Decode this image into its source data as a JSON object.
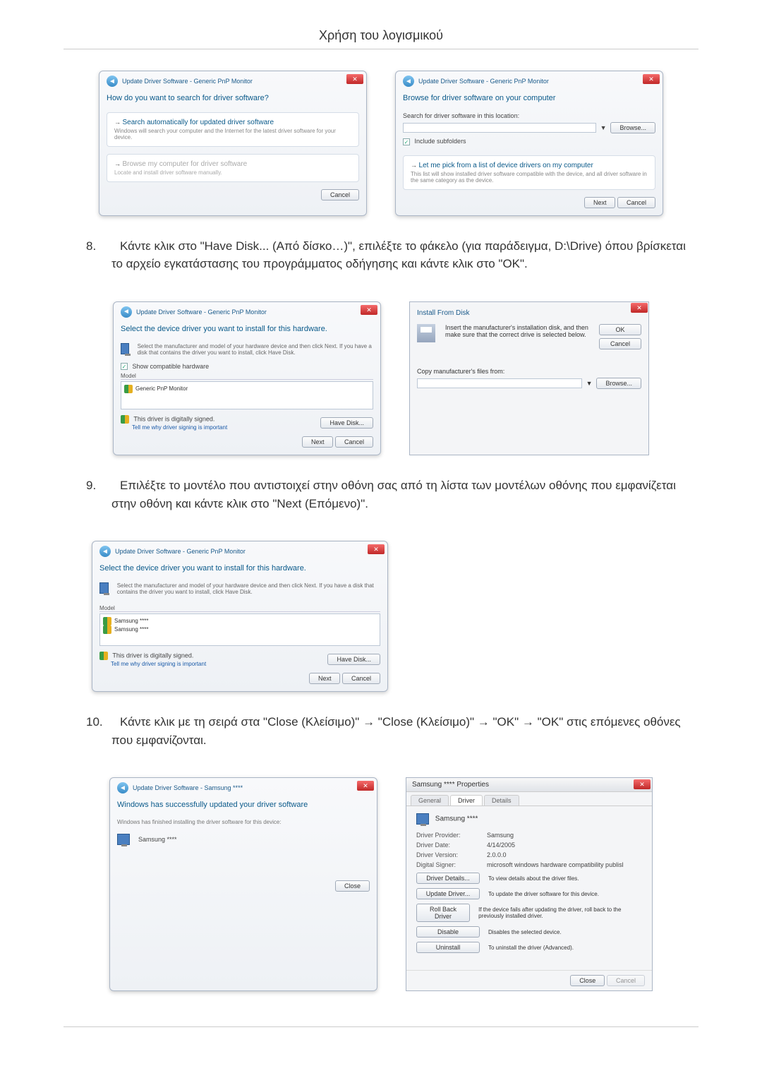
{
  "header": {
    "title": "Χρήση του λογισμικού"
  },
  "steps": {
    "s8": {
      "num": "8.",
      "text": "Κάντε κλικ στο \"Have Disk... (Από δίσκο…)\", επιλέξτε το φάκελο (για παράδειγμα, D:\\Drive) όπου βρίσκεται το αρχείο εγκατάστασης του προγράμματος οδήγησης και κάντε κλικ στο \"OK\"."
    },
    "s9": {
      "num": "9.",
      "text": "Επιλέξτε το μοντέλο που αντιστοιχεί στην οθόνη σας από τη λίστα των μοντέλων οθόνης που εμφανίζεται στην οθόνη και κάντε κλικ στο \"Next (Επόμενο)\"."
    },
    "s10": {
      "num": "10.",
      "text": "Κάντε κλικ με τη σειρά στα \"Close (Κλείσιμο)\" → \"Close (Κλείσιμο)\" → \"OK\" → \"OK\" στις επόμενες οθόνες που εμφανίζονται."
    }
  },
  "d1": {
    "title": "Update Driver Software - Generic PnP Monitor",
    "heading": "How do you want to search for driver software?",
    "opt1_title": "Search automatically for updated driver software",
    "opt1_sub": "Windows will search your computer and the Internet for the latest driver software for your device.",
    "opt2_title": "Browse my computer for driver software",
    "opt2_sub": "Locate and install driver software manually.",
    "cancel": "Cancel"
  },
  "d2": {
    "title": "Update Driver Software - Generic PnP Monitor",
    "heading": "Browse for driver software on your computer",
    "search_label": "Search for driver software in this location:",
    "path": "",
    "browse": "Browse...",
    "include_sub": "Include subfolders",
    "pick_title": "Let me pick from a list of device drivers on my computer",
    "pick_sub": "This list will show installed driver software compatible with the device, and all driver software in the same category as the device.",
    "next": "Next",
    "cancel": "Cancel"
  },
  "d3": {
    "title": "Update Driver Software - Generic PnP Monitor",
    "heading": "Select the device driver you want to install for this hardware.",
    "help": "Select the manufacturer and model of your hardware device and then click Next. If you have a disk that contains the driver you want to install, click Have Disk.",
    "compat": "Show compatible hardware",
    "model_hdr": "Model",
    "model1": "Generic PnP Monitor",
    "signed": "This driver is digitally signed.",
    "why": "Tell me why driver signing is important",
    "have_disk": "Have Disk...",
    "next": "Next",
    "cancel": "Cancel"
  },
  "d4": {
    "title": "Install From Disk",
    "msg": "Insert the manufacturer's installation disk, and then make sure that the correct drive is selected below.",
    "ok": "OK",
    "cancel": "Cancel",
    "copy_label": "Copy manufacturer's files from:",
    "browse": "Browse..."
  },
  "d5": {
    "title": "Update Driver Software - Generic PnP Monitor",
    "heading": "Select the device driver you want to install for this hardware.",
    "help": "Select the manufacturer and model of your hardware device and then click Next. If you have a disk that contains the driver you want to install, click Have Disk.",
    "model_hdr": "Model",
    "m1": "Samsung ****",
    "m2": "Samsung ****",
    "signed": "This driver is digitally signed.",
    "why": "Tell me why driver signing is important",
    "have_disk": "Have Disk...",
    "next": "Next",
    "cancel": "Cancel"
  },
  "d6": {
    "title": "Update Driver Software - Samsung ****",
    "heading": "Windows has successfully updated your driver software",
    "sub": "Windows has finished installing the driver software for this device:",
    "device": "Samsung ****",
    "close": "Close"
  },
  "d7": {
    "title": "Samsung **** Properties",
    "tab_general": "General",
    "tab_driver": "Driver",
    "tab_details": "Details",
    "name": "Samsung ****",
    "provider_l": "Driver Provider:",
    "provider_v": "Samsung",
    "date_l": "Driver Date:",
    "date_v": "4/14/2005",
    "ver_l": "Driver Version:",
    "ver_v": "2.0.0.0",
    "signer_l": "Digital Signer:",
    "signer_v": "microsoft windows hardware compatibility publisl",
    "btn_details": "Driver Details...",
    "btn_details_d": "To view details about the driver files.",
    "btn_update": "Update Driver...",
    "btn_update_d": "To update the driver software for this device.",
    "btn_rollback": "Roll Back Driver",
    "btn_rollback_d": "If the device fails after updating the driver, roll back to the previously installed driver.",
    "btn_disable": "Disable",
    "btn_disable_d": "Disables the selected device.",
    "btn_uninstall": "Uninstall",
    "btn_uninstall_d": "To uninstall the driver (Advanced).",
    "close": "Close",
    "cancel": "Cancel"
  }
}
